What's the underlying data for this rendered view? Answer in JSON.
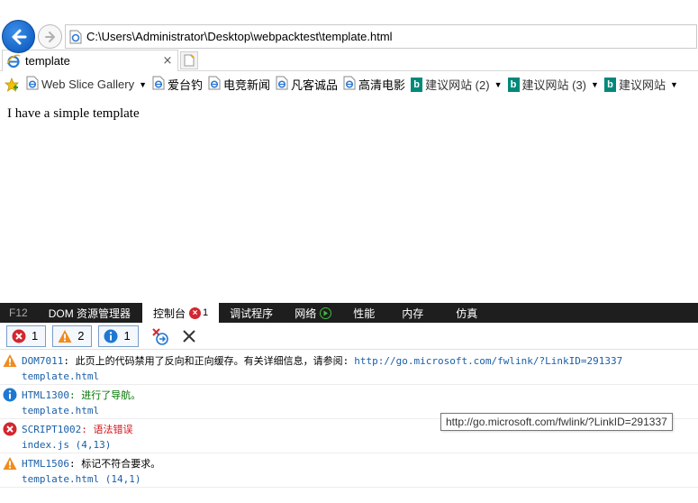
{
  "browser": {
    "address_url": "C:\\Users\\Administrator\\Desktop\\webpacktest\\template.html",
    "tab_title": "template",
    "tab_close": "×"
  },
  "favorites": [
    {
      "label": "Web Slice Gallery",
      "icon": "ie-page-icon",
      "dropdown": true,
      "muted": true
    },
    {
      "label": "爱台钓",
      "icon": "ie-page-icon",
      "dropdown": false
    },
    {
      "label": "电竞新闻",
      "icon": "ie-page-icon",
      "dropdown": false
    },
    {
      "label": "凡客诚品",
      "icon": "ie-page-icon",
      "dropdown": false
    },
    {
      "label": "高清电影",
      "icon": "ie-page-icon",
      "dropdown": false
    },
    {
      "label": "建议网站 (2)",
      "icon": "bing-icon",
      "dropdown": true,
      "muted": true
    },
    {
      "label": "建议网站 (3)",
      "icon": "bing-icon",
      "dropdown": true,
      "muted": true
    },
    {
      "label": "建议网站",
      "icon": "bing-icon",
      "dropdown": true,
      "muted": true
    }
  ],
  "page": {
    "body_text": "I have a simple template"
  },
  "devtools": {
    "tabs": [
      {
        "label": "F12"
      },
      {
        "label": "DOM 资源管理器"
      },
      {
        "label": "控制台",
        "active": true,
        "error_count": "1"
      },
      {
        "label": "调试程序"
      },
      {
        "label": "网络"
      },
      {
        "label": "性能"
      },
      {
        "label": "内存"
      },
      {
        "label": "仿真"
      }
    ],
    "filters": {
      "errors": "1",
      "warnings": "2",
      "info": "1"
    },
    "messages": [
      {
        "level": "warning",
        "code": "DOM7011",
        "text": ": 此页上的代码禁用了反向和正向缓存。有关详细信息，请参阅:",
        "link": "http://go.microsoft.com/fwlink/?LinkID=291337",
        "source": "template.html"
      },
      {
        "level": "info",
        "code": "HTML1300",
        "text": ": 进行了导航。",
        "source": "template.html"
      },
      {
        "level": "error",
        "code": "SCRIPT1002",
        "text": ": 语法错误",
        "source": "index.js (4,13)"
      },
      {
        "level": "warning",
        "code": "HTML1506",
        "text": ": 标记不符合要求。",
        "source": "template.html (14,1)"
      }
    ],
    "tooltip": "http://go.microsoft.com/fwlink/?LinkID=291337"
  },
  "colors": {
    "error": "#d3262f",
    "warning": "#f08c1e",
    "info": "#1e78d2",
    "link": "#1a5fa8",
    "devtools_bar": "#1e1e1e"
  }
}
